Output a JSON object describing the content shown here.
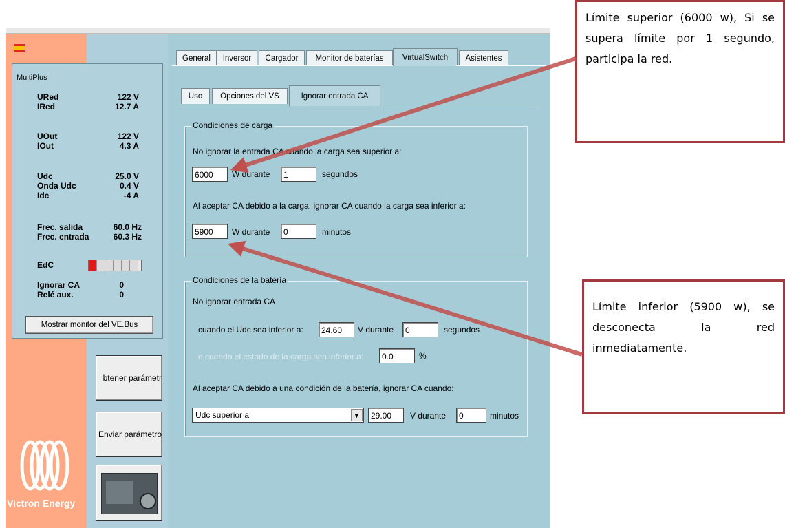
{
  "app": {
    "status": {
      "group_title": "MultiPlus",
      "rows": [
        {
          "label": "URed",
          "value": "122 V"
        },
        {
          "label": "IRed",
          "value": "12.7 A"
        },
        {
          "label": "UOut",
          "value": "122 V"
        },
        {
          "label": "IOut",
          "value": "4.3 A"
        },
        {
          "label": "Udc",
          "value": "25.0 V"
        },
        {
          "label": "Onda Udc",
          "value": "0.4 V"
        },
        {
          "label": "Idc",
          "value": "-4 A"
        },
        {
          "label": "Frec. salida",
          "value": "60.0 Hz"
        },
        {
          "label": "Frec. entrada",
          "value": "60.3 Hz"
        },
        {
          "label": "EdC",
          "value": ""
        },
        {
          "label": "Ignorar CA",
          "value": "0"
        },
        {
          "label": "Relé aux.",
          "value": "0"
        }
      ],
      "soc_segments_on": 1,
      "soc_segments_total": 6,
      "monitor_button": "Mostrar monitor del VE.Bus"
    },
    "buttons": {
      "obtener": "btener parámetr",
      "enviar": "Enviar parámetro"
    },
    "logo_text": "Victron Energy",
    "main_tabs": [
      "General",
      "Inversor",
      "Cargador",
      "Monitor de baterías",
      "VirtualSwitch",
      "Asistentes"
    ],
    "main_tab_active": "VirtualSwitch",
    "sub_tabs": [
      "Uso",
      "Opciones del VS",
      "Ignorar entrada CA"
    ],
    "sub_tab_active": "Ignorar entrada CA",
    "carga": {
      "legend": "Condiciones de carga",
      "line1": "No ignorar la entrada CA cuando la carga sea superior a:",
      "upper_value": "6000",
      "upper_unit": "W durante",
      "upper_time": "1",
      "upper_time_unit": "segundos",
      "line2": "Al aceptar CA debido a la carga, ignorar CA cuando la carga sea inferior a:",
      "lower_value": "5900",
      "lower_unit": "W durante",
      "lower_time": "0",
      "lower_time_unit": "minutos"
    },
    "bateria": {
      "legend": "Condiciones de la batería",
      "line1": "No ignorar entrada CA",
      "udc_label": "cuando el Udc sea inferior a:",
      "udc_value": "24.60",
      "udc_unit": "V durante",
      "udc_time": "0",
      "udc_time_unit": "segundos",
      "soc_label": "o cuando el estado de la carga sea inferior a:",
      "soc_value": "0.0",
      "soc_unit": "%",
      "line3": "Al aceptar CA debido a una condición de la batería, ignorar CA cuando:",
      "select_value": "Udc superior a",
      "sel_value": "29.00",
      "sel_unit": "V durante",
      "sel_time": "0",
      "sel_time_unit": "minutos"
    }
  },
  "notes": {
    "upper": "Límite superior (6000 w), Si se supera límite por 1 segundo, participa la red.",
    "lower": "Límite inferior (5900 w), se desconecta la red inmediatamente."
  },
  "colors": {
    "left_panel": "#ffa883",
    "main_bg": "#a6ccd8",
    "note_border": "#a33a3e",
    "arrow": "#c0504d"
  }
}
